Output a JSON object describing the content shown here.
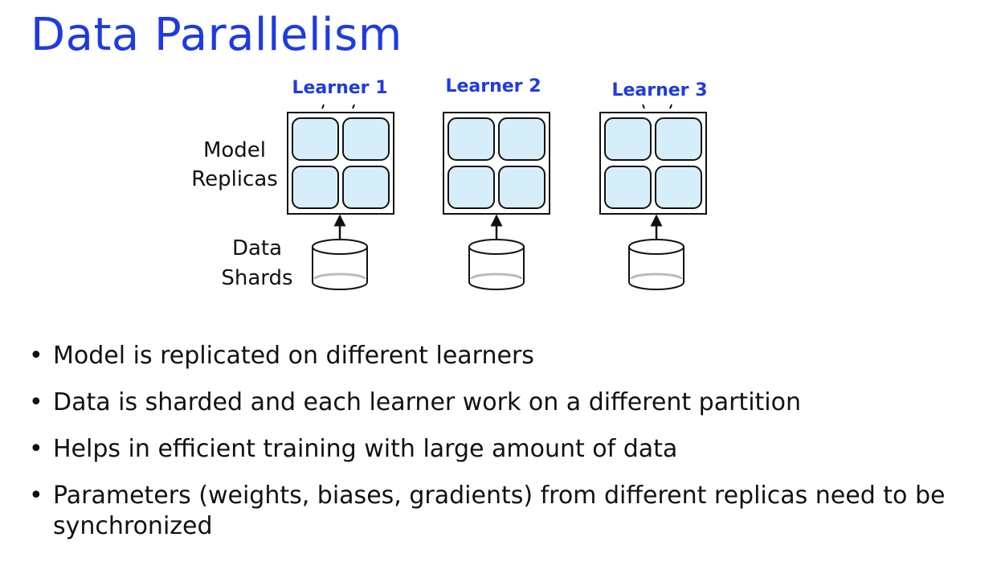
{
  "slide": {
    "title": "Data Parallelism"
  },
  "diagram": {
    "colors": {
      "accent": "#1f3be0",
      "cell_fill": "#d6eef9",
      "stroke": "#111111"
    },
    "row_labels": {
      "model_line1": "Model",
      "model_line2": "Replicas",
      "data_line1": "Data",
      "data_line2": "Shards"
    },
    "learners": [
      {
        "label": "Learner 1"
      },
      {
        "label": "Learner 2"
      },
      {
        "label": "Learner 3"
      }
    ]
  },
  "bullets": [
    {
      "text": "Model is replicated on different learners"
    },
    {
      "text": "Data is sharded and each learner work on a different partition"
    },
    {
      "text": "Helps in efficient training with large amount of data"
    },
    {
      "text": "Parameters (weights, biases, gradients) from different replicas need to be synchronized"
    }
  ]
}
